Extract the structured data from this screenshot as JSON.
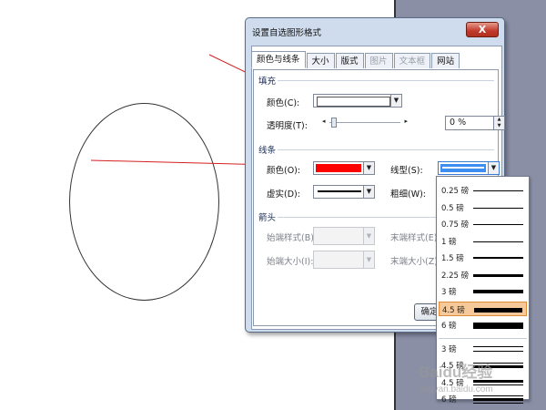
{
  "dialog": {
    "title": "设置自选图形格式",
    "close_label": "X",
    "tabs": [
      {
        "label": "颜色与线条",
        "active": true
      },
      {
        "label": "大小"
      },
      {
        "label": "版式"
      },
      {
        "label": "图片",
        "disabled": true
      },
      {
        "label": "文本框",
        "disabled": true
      },
      {
        "label": "网站"
      }
    ],
    "fill": {
      "section_label": "填充",
      "color_label": "颜色(C):",
      "color_value": "#ffffff",
      "transparency_label": "透明度(T):",
      "transparency_value": "0 %",
      "transparency_fraction": 0
    },
    "line": {
      "section_label": "线条",
      "color_label": "颜色(O):",
      "color_value": "#ff0000",
      "dash_label": "虚实(D):",
      "style_label": "线型(S):",
      "weight_label": "粗细(W):"
    },
    "arrows": {
      "section_label": "箭头",
      "begin_style_label": "始端样式(B):",
      "end_style_label": "末端样式(E):",
      "begin_size_label": "始端大小(I):",
      "end_size_label": "末端大小(Z):"
    },
    "ok_label": "确定"
  },
  "line_style_dropdown": {
    "items": [
      {
        "label": "0.25 磅",
        "weight": 0.25
      },
      {
        "label": "0.5 磅",
        "weight": 0.5
      },
      {
        "label": "0.75 磅",
        "weight": 0.75
      },
      {
        "label": "1 磅",
        "weight": 1
      },
      {
        "label": "1.5 磅",
        "weight": 1.5
      },
      {
        "label": "2.25 磅",
        "weight": 2.25
      },
      {
        "label": "3 磅",
        "weight": 3
      },
      {
        "label": "4.5 磅",
        "weight": 4.5,
        "selected": true
      },
      {
        "label": "6 磅",
        "weight": 6
      },
      {
        "label": "3 磅",
        "weight": 3,
        "compound": "double"
      },
      {
        "label": "4.5 磅",
        "weight": 4.5,
        "compound": "thin-thick"
      },
      {
        "label": "4.5 磅",
        "weight": 4.5,
        "compound": "thick-thin"
      },
      {
        "label": "6 磅",
        "weight": 6,
        "compound": "triple"
      }
    ]
  },
  "watermark": {
    "text": "Baidu经验",
    "sub": "jingyan.baidu.com"
  },
  "colors": {
    "arrow_line": "#d42020",
    "selected_item": "#f5c99a",
    "panel_background": "#8a8fa6"
  }
}
